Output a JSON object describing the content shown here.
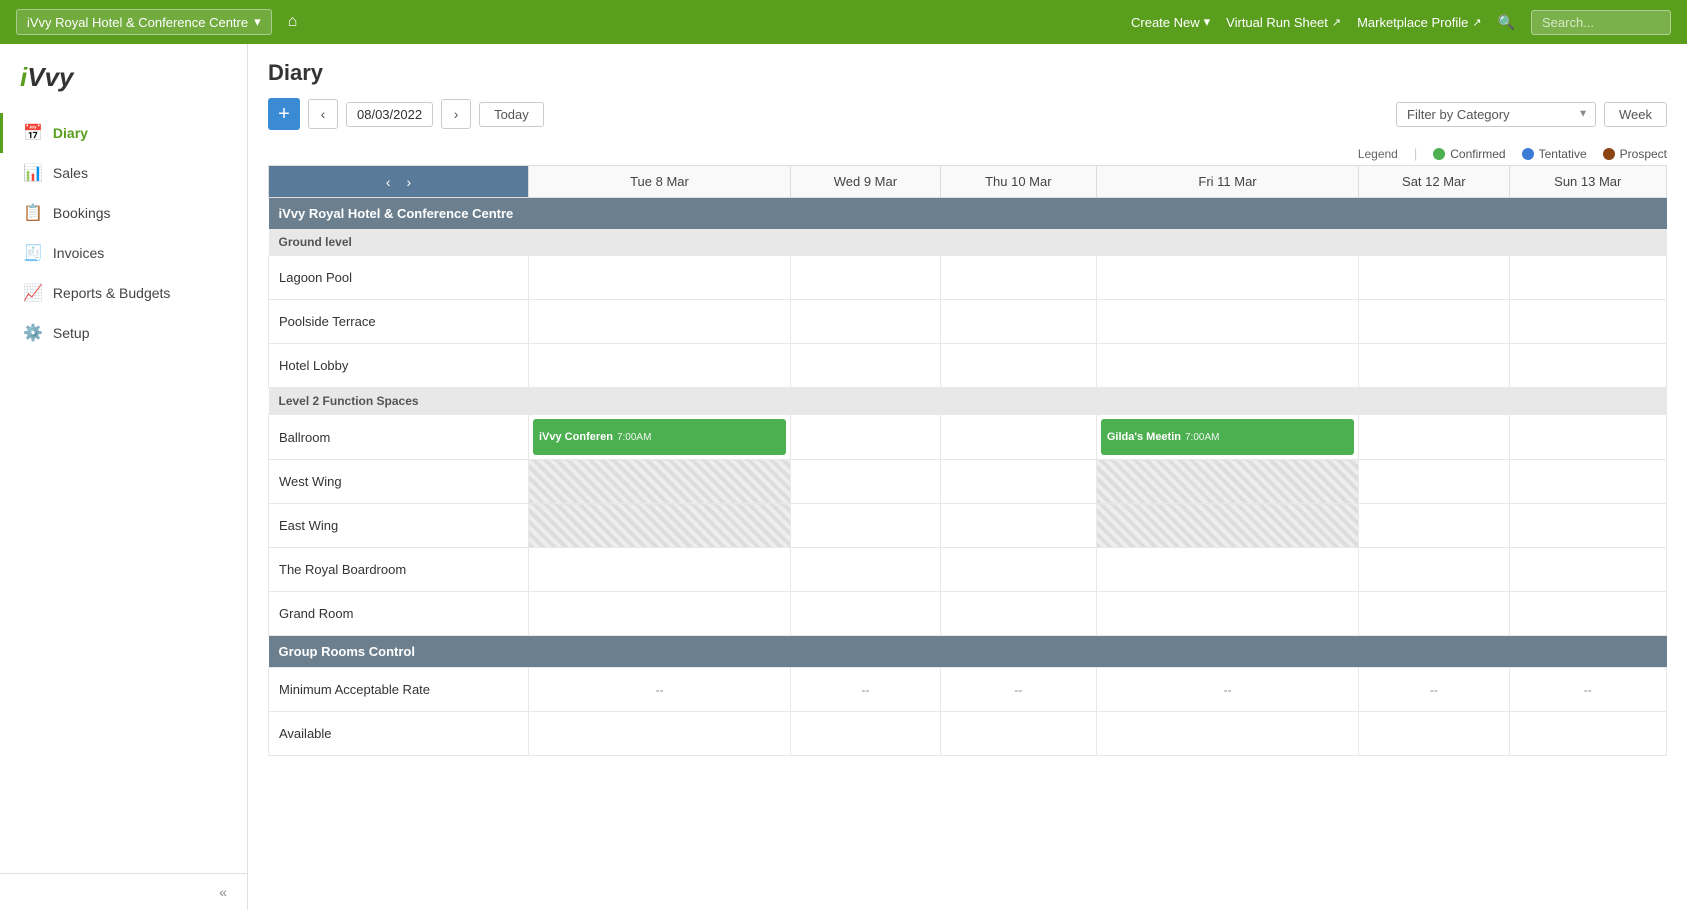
{
  "navbar": {
    "venue": "iVvy Royal Hotel & Conference Centre",
    "home_label": "⌂",
    "create_new_label": "Create New",
    "virtual_run_sheet_label": "Virtual Run Sheet",
    "marketplace_profile_label": "Marketplace Profile",
    "search_placeholder": "Search..."
  },
  "sidebar": {
    "logo": "iVvy",
    "items": [
      {
        "id": "diary",
        "label": "Diary",
        "icon": "📅",
        "active": true
      },
      {
        "id": "sales",
        "label": "Sales",
        "icon": "📊"
      },
      {
        "id": "bookings",
        "label": "Bookings",
        "icon": "📋"
      },
      {
        "id": "invoices",
        "label": "Invoices",
        "icon": "🧾"
      },
      {
        "id": "reports",
        "label": "Reports & Budgets",
        "icon": "📈"
      },
      {
        "id": "setup",
        "label": "Setup",
        "icon": "⚙️"
      }
    ],
    "collapse_label": "«"
  },
  "diary": {
    "title": "Diary",
    "current_date": "08/03/2022",
    "today_label": "Today",
    "filter_placeholder": "Filter by Category",
    "view_label": "Week",
    "legend_label": "Legend",
    "legend": [
      {
        "id": "confirmed",
        "label": "Confirmed",
        "color": "#4caf50"
      },
      {
        "id": "tentative",
        "label": "Tentative",
        "color": "#3a7bd5"
      },
      {
        "id": "prospect",
        "label": "Prospect",
        "color": "#8b4513"
      }
    ],
    "days": [
      {
        "label": "Tue 8 Mar"
      },
      {
        "label": "Wed 9 Mar"
      },
      {
        "label": "Thu 10 Mar"
      },
      {
        "label": "Fri 11 Mar"
      },
      {
        "label": "Sat 12 Mar"
      },
      {
        "label": "Sun 13 Mar"
      }
    ],
    "venue_section": "iVvy Royal Hotel & Conference Centre",
    "sections": [
      {
        "id": "ground-level",
        "label": "Ground level",
        "rooms": [
          {
            "name": "Lagoon Pool",
            "days": [
              "",
              "",
              "",
              "",
              "",
              ""
            ]
          },
          {
            "name": "Poolside Terrace",
            "days": [
              "",
              "",
              "",
              "",
              "",
              ""
            ]
          },
          {
            "name": "Hotel Lobby",
            "days": [
              "",
              "",
              "",
              "",
              "",
              ""
            ]
          }
        ]
      },
      {
        "id": "level-2",
        "label": "Level 2 Function Spaces",
        "rooms": [
          {
            "name": "Ballroom",
            "days": [
              {
                "type": "event",
                "name": "iVvy Conferen",
                "time": "7:00AM",
                "status": "confirmed"
              },
              {
                "type": "empty"
              },
              {
                "type": "empty"
              },
              {
                "type": "event",
                "name": "Gilda's Meetin",
                "time": "7:00AM",
                "status": "confirmed"
              },
              {
                "type": "empty"
              },
              {
                "type": "empty"
              }
            ]
          },
          {
            "name": "West Wing",
            "days": [
              {
                "type": "striped"
              },
              {
                "type": "empty"
              },
              {
                "type": "empty"
              },
              {
                "type": "striped"
              },
              {
                "type": "empty"
              },
              {
                "type": "empty"
              }
            ]
          },
          {
            "name": "East Wing",
            "days": [
              {
                "type": "striped"
              },
              {
                "type": "empty"
              },
              {
                "type": "empty"
              },
              {
                "type": "striped"
              },
              {
                "type": "empty"
              },
              {
                "type": "empty"
              }
            ]
          },
          {
            "name": "The Royal Boardroom",
            "days": [
              "",
              "",
              "",
              "",
              "",
              ""
            ]
          },
          {
            "name": "Grand Room",
            "days": [
              "",
              "",
              "",
              "",
              "",
              ""
            ]
          }
        ]
      },
      {
        "id": "group-rooms",
        "label": "Group Rooms Control",
        "isSection": true,
        "rooms": [
          {
            "name": "Minimum Acceptable Rate",
            "days": [
              {
                "type": "rate",
                "value": "--"
              },
              {
                "type": "rate",
                "value": "--"
              },
              {
                "type": "rate",
                "value": "--"
              },
              {
                "type": "rate",
                "value": "--"
              },
              {
                "type": "rate",
                "value": "--"
              },
              {
                "type": "rate",
                "value": "--"
              }
            ]
          },
          {
            "name": "Available",
            "days": [
              "",
              "",
              "",
              "",
              "",
              ""
            ]
          }
        ]
      }
    ]
  }
}
